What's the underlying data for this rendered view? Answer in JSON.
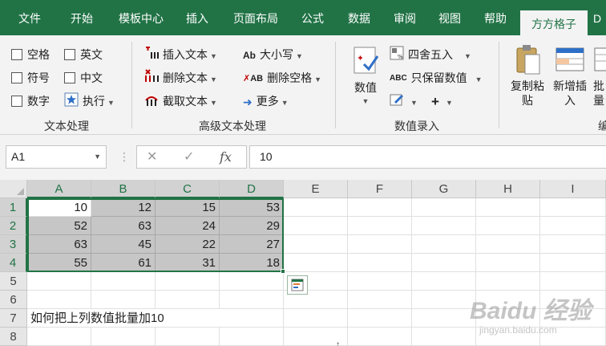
{
  "tabs": [
    "文件",
    "开始",
    "模板中心",
    "插入",
    "页面布局",
    "公式",
    "数据",
    "审阅",
    "视图",
    "帮助",
    "方方格子",
    "D"
  ],
  "active_tab": "方方格子",
  "ribbon": {
    "text_processing": {
      "checkboxes": [
        "空格",
        "英文",
        "符号",
        "中文",
        "数字"
      ],
      "execute": "执行",
      "label": "文本处理"
    },
    "advanced_text": {
      "insert_text": "插入文本",
      "delete_text": "删除文本",
      "extract_text": "截取文本",
      "case": "大小写",
      "delete_spaces": "删除空格",
      "more": "更多",
      "label": "高级文本处理"
    },
    "numeric_input": {
      "numeric": "数值",
      "round": "四舍五入",
      "keep_numeric": "只保留数值",
      "label": "数值录入"
    },
    "copy_paste": "复制粘贴",
    "add_insert": "新增插入",
    "batch": "批量",
    "partial_label": "编"
  },
  "formula_bar": {
    "name_box": "A1",
    "cancel_symbol": "✕",
    "enter_symbol": "✓",
    "fx": "fx",
    "formula": "10"
  },
  "sheet": {
    "columns": [
      "A",
      "B",
      "C",
      "D",
      "E",
      "F",
      "G",
      "H",
      "I"
    ],
    "rows": [
      "1",
      "2",
      "3",
      "4",
      "5",
      "6",
      "7",
      "8"
    ],
    "data": [
      [
        "10",
        "12",
        "15",
        "53"
      ],
      [
        "52",
        "63",
        "24",
        "29"
      ],
      [
        "63",
        "45",
        "22",
        "27"
      ],
      [
        "55",
        "61",
        "31",
        "18"
      ]
    ],
    "a7": "如何把上列数值批量加10",
    "selection": "A1:D4"
  },
  "watermark": {
    "logo": "Baidu 经验",
    "url": "jingyan.baidu.com"
  },
  "colors": {
    "excel_green": "#217346",
    "selected_cells": "#c6c6c6"
  }
}
